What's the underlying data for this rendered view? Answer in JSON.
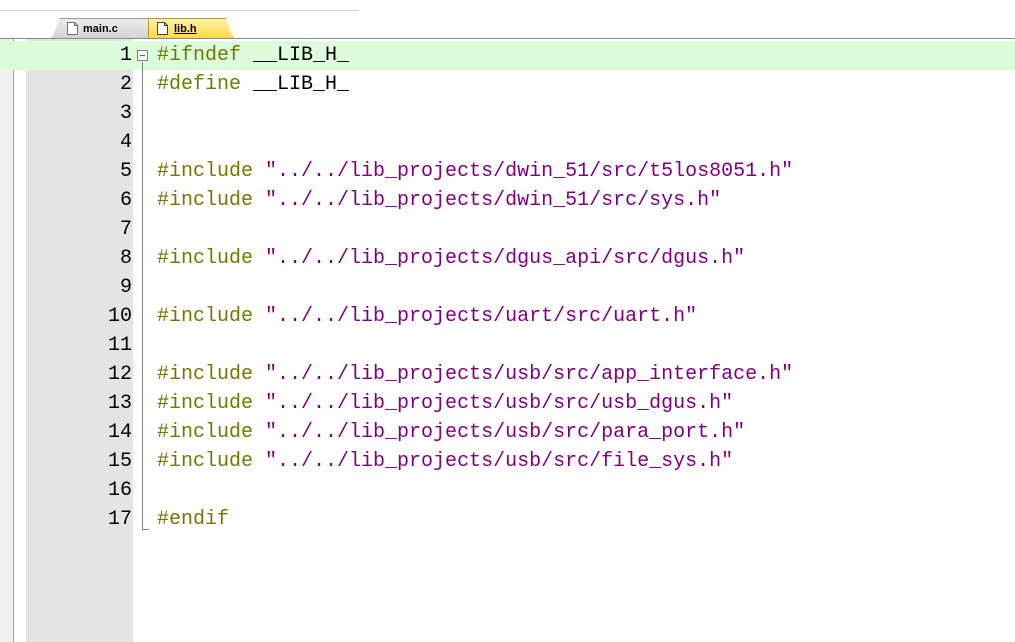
{
  "tabs": [
    {
      "label": "main.c",
      "active": false,
      "icon": "file-icon"
    },
    {
      "label": "lib.h",
      "active": true,
      "icon": "file-icon"
    }
  ],
  "editor": {
    "lines": [
      {
        "num": "1",
        "directive": "#ifndef",
        "arg": " __LIB_H_",
        "string": ""
      },
      {
        "num": "2",
        "directive": "#define",
        "arg": " __LIB_H_",
        "string": ""
      },
      {
        "num": "3",
        "directive": "",
        "arg": "",
        "string": ""
      },
      {
        "num": "4",
        "directive": "",
        "arg": "",
        "string": ""
      },
      {
        "num": "5",
        "directive": "#include",
        "arg": " ",
        "string": "\"../../lib_projects/dwin_51/src/t5los8051.h\""
      },
      {
        "num": "6",
        "directive": "#include",
        "arg": " ",
        "string": "\"../../lib_projects/dwin_51/src/sys.h\""
      },
      {
        "num": "7",
        "directive": "",
        "arg": "",
        "string": ""
      },
      {
        "num": "8",
        "directive": "#include",
        "arg": " ",
        "string": "\"../../lib_projects/dgus_api/src/dgus.h\""
      },
      {
        "num": "9",
        "directive": "",
        "arg": "",
        "string": ""
      },
      {
        "num": "10",
        "directive": "#include",
        "arg": " ",
        "string": "\"../../lib_projects/uart/src/uart.h\""
      },
      {
        "num": "11",
        "directive": "",
        "arg": "",
        "string": ""
      },
      {
        "num": "12",
        "directive": "#include",
        "arg": " ",
        "string": "\"../../lib_projects/usb/src/app_interface.h\""
      },
      {
        "num": "13",
        "directive": "#include",
        "arg": " ",
        "string": "\"../../lib_projects/usb/src/usb_dgus.h\""
      },
      {
        "num": "14",
        "directive": "#include",
        "arg": " ",
        "string": "\"../../lib_projects/usb/src/para_port.h\""
      },
      {
        "num": "15",
        "directive": "#include",
        "arg": " ",
        "string": "\"../../lib_projects/usb/src/file_sys.h\""
      },
      {
        "num": "16",
        "directive": "",
        "arg": "",
        "string": ""
      },
      {
        "num": "17",
        "directive": "#endif",
        "arg": "",
        "string": ""
      }
    ]
  },
  "colors": {
    "directive": "#6e7a00",
    "string": "#800080",
    "current_line": "#dcfcdc",
    "gutter": "#e4e4e4"
  }
}
